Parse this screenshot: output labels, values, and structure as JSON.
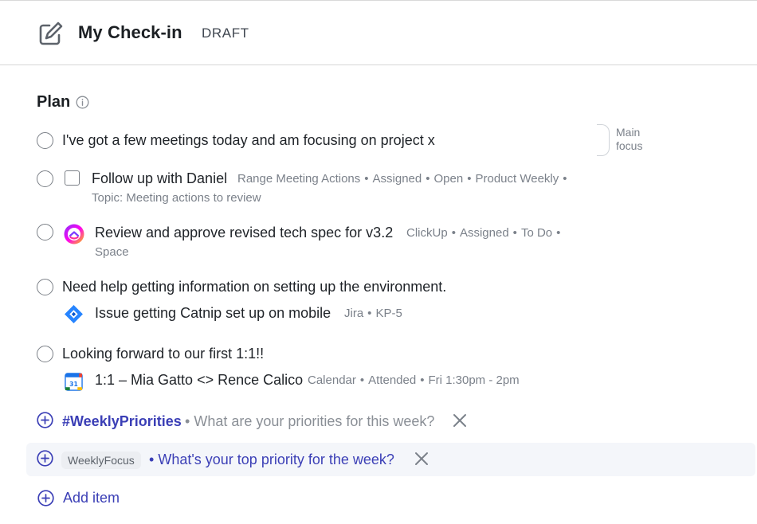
{
  "header": {
    "title": "My Check-in",
    "status": "DRAFT"
  },
  "plan": {
    "title": "Plan",
    "main_focus_label": "Main focus",
    "items": [
      {
        "text": "I've got a few meetings today and am focusing on project x"
      },
      {
        "text": "Follow up with Daniel",
        "meta_line1": [
          "Range Meeting Actions",
          "Assigned",
          "Open",
          "Product Weekly"
        ],
        "meta_line2": "Topic: Meeting actions to review"
      },
      {
        "text": "Review and approve revised tech spec for v3.2",
        "meta_line1": [
          "ClickUp",
          "Assigned",
          "To Do"
        ],
        "meta_line2": "Space"
      },
      {
        "text": "Need help getting information on setting up the environment.",
        "sub": {
          "text": "Issue getting Catnip set up on mobile",
          "meta": [
            "Jira",
            "KP-5"
          ]
        }
      },
      {
        "text": "Looking forward to our first 1:1!!",
        "sub": {
          "text": "1:1 – Mia Gatto <> Rence Calico",
          "meta": [
            "Calendar",
            "Attended",
            "Fri 1:30pm - 2pm"
          ],
          "calendar_day": "31"
        }
      }
    ],
    "prompts": [
      {
        "hashtag": "#WeeklyPriorities",
        "question": "What are your priorities for this week?"
      },
      {
        "tag": "WeeklyFocus",
        "question": "What's your top priority for the week?"
      }
    ],
    "add_item_label": "Add item"
  },
  "separator": "•",
  "colors": {
    "accent": "#3b3fb6",
    "muted": "#7b818a"
  },
  "icons": [
    "edit-icon",
    "info-icon",
    "clickup-icon",
    "jira-icon",
    "google-calendar-icon",
    "plus-circle-icon",
    "close-icon"
  ]
}
